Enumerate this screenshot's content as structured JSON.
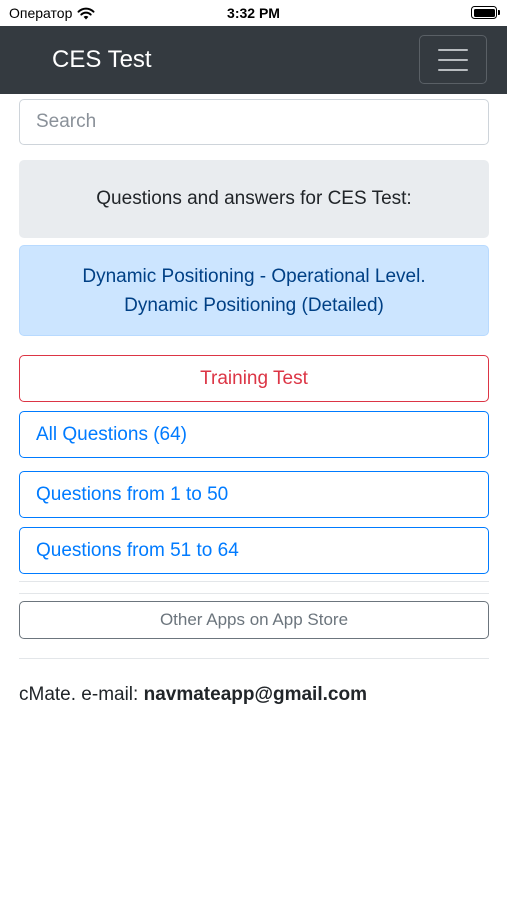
{
  "status_bar": {
    "carrier": "Оператор",
    "time": "3:32 PM"
  },
  "navbar": {
    "brand": "CES Test",
    "menu_icon": "hamburger-menu-icon"
  },
  "search": {
    "placeholder": "Search"
  },
  "intro": {
    "text": "Questions and answers for CES Test:"
  },
  "topic": {
    "line1": "Dynamic Positioning - Operational Level.",
    "line2": "Dynamic Positioning (Detailed)"
  },
  "buttons": {
    "training_test": "Training Test",
    "all_questions": "All Questions (64)",
    "range_1": "Questions from 1 to 50",
    "range_2": "Questions from 51 to 64",
    "other_apps": "Other Apps on App Store"
  },
  "footer": {
    "label": "cMate. e-mail: ",
    "email": "navmateapp@gmail.com"
  },
  "colors": {
    "navbar": "#343a40",
    "danger": "#dc3545",
    "primary": "#007bff",
    "secondary": "#6c757d",
    "info_bg": "#cce5ff"
  }
}
